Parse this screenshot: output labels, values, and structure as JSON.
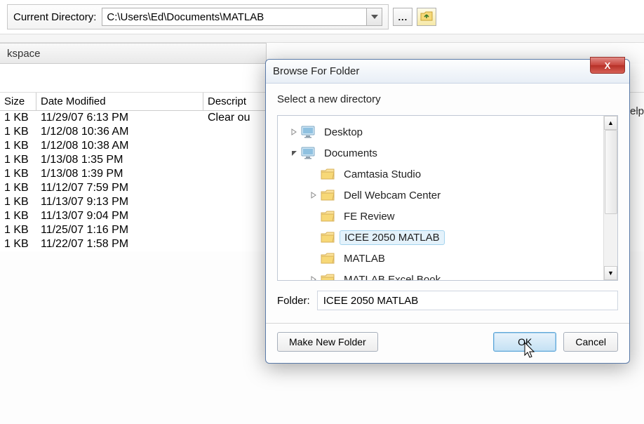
{
  "toolbar": {
    "current_dir_label": "Current Directory:",
    "current_dir_value": "C:\\Users\\Ed\\Documents\\MATLAB",
    "browse_label": "...",
    "up_label": "↑"
  },
  "workspace": {
    "title": "kspace"
  },
  "table": {
    "headers": {
      "size": "Size",
      "date": "Date Modified",
      "desc": "Descript"
    },
    "rows": [
      {
        "size": "1 KB",
        "date": "11/29/07 6:13 PM",
        "desc": "Clear ou"
      },
      {
        "size": "1 KB",
        "date": "1/12/08 10:36 AM",
        "desc": ""
      },
      {
        "size": "1 KB",
        "date": "1/12/08 10:38 AM",
        "desc": ""
      },
      {
        "size": "1 KB",
        "date": "1/13/08 1:35 PM",
        "desc": ""
      },
      {
        "size": "1 KB",
        "date": "1/13/08 1:39 PM",
        "desc": ""
      },
      {
        "size": "1 KB",
        "date": "11/12/07 7:59 PM",
        "desc": ""
      },
      {
        "size": "1 KB",
        "date": "11/13/07 9:13 PM",
        "desc": ""
      },
      {
        "size": "1 KB",
        "date": "11/13/07 9:04 PM",
        "desc": ""
      },
      {
        "size": "1 KB",
        "date": "11/25/07 1:16 PM",
        "desc": ""
      },
      {
        "size": "1 KB",
        "date": "11/22/07 1:58 PM",
        "desc": ""
      }
    ]
  },
  "dialog": {
    "title": "Browse For Folder",
    "instruction": "Select a new directory",
    "tree": [
      {
        "level": 0,
        "expander": "▷",
        "icon": "monitor",
        "label": "Desktop",
        "selected": false
      },
      {
        "level": 0,
        "expander": "◢",
        "icon": "monitor",
        "label": "Documents",
        "selected": false
      },
      {
        "level": 1,
        "expander": "",
        "icon": "folder",
        "label": "Camtasia Studio",
        "selected": false
      },
      {
        "level": 1,
        "expander": "▷",
        "icon": "folder",
        "label": "Dell Webcam Center",
        "selected": false
      },
      {
        "level": 1,
        "expander": "",
        "icon": "folder",
        "label": "FE Review",
        "selected": false
      },
      {
        "level": 1,
        "expander": "",
        "icon": "folder",
        "label": "ICEE 2050 MATLAB",
        "selected": true
      },
      {
        "level": 1,
        "expander": "",
        "icon": "folder",
        "label": "MATLAB",
        "selected": false
      },
      {
        "level": 1,
        "expander": "▷",
        "icon": "folder",
        "label": "MATLAB Excel Book",
        "selected": false
      }
    ],
    "folder_label": "Folder:",
    "folder_value": "ICEE 2050 MATLAB",
    "make_new_folder": "Make New Folder",
    "ok": "OK",
    "cancel": "Cancel",
    "close": "X"
  },
  "fragment_right": "elp"
}
